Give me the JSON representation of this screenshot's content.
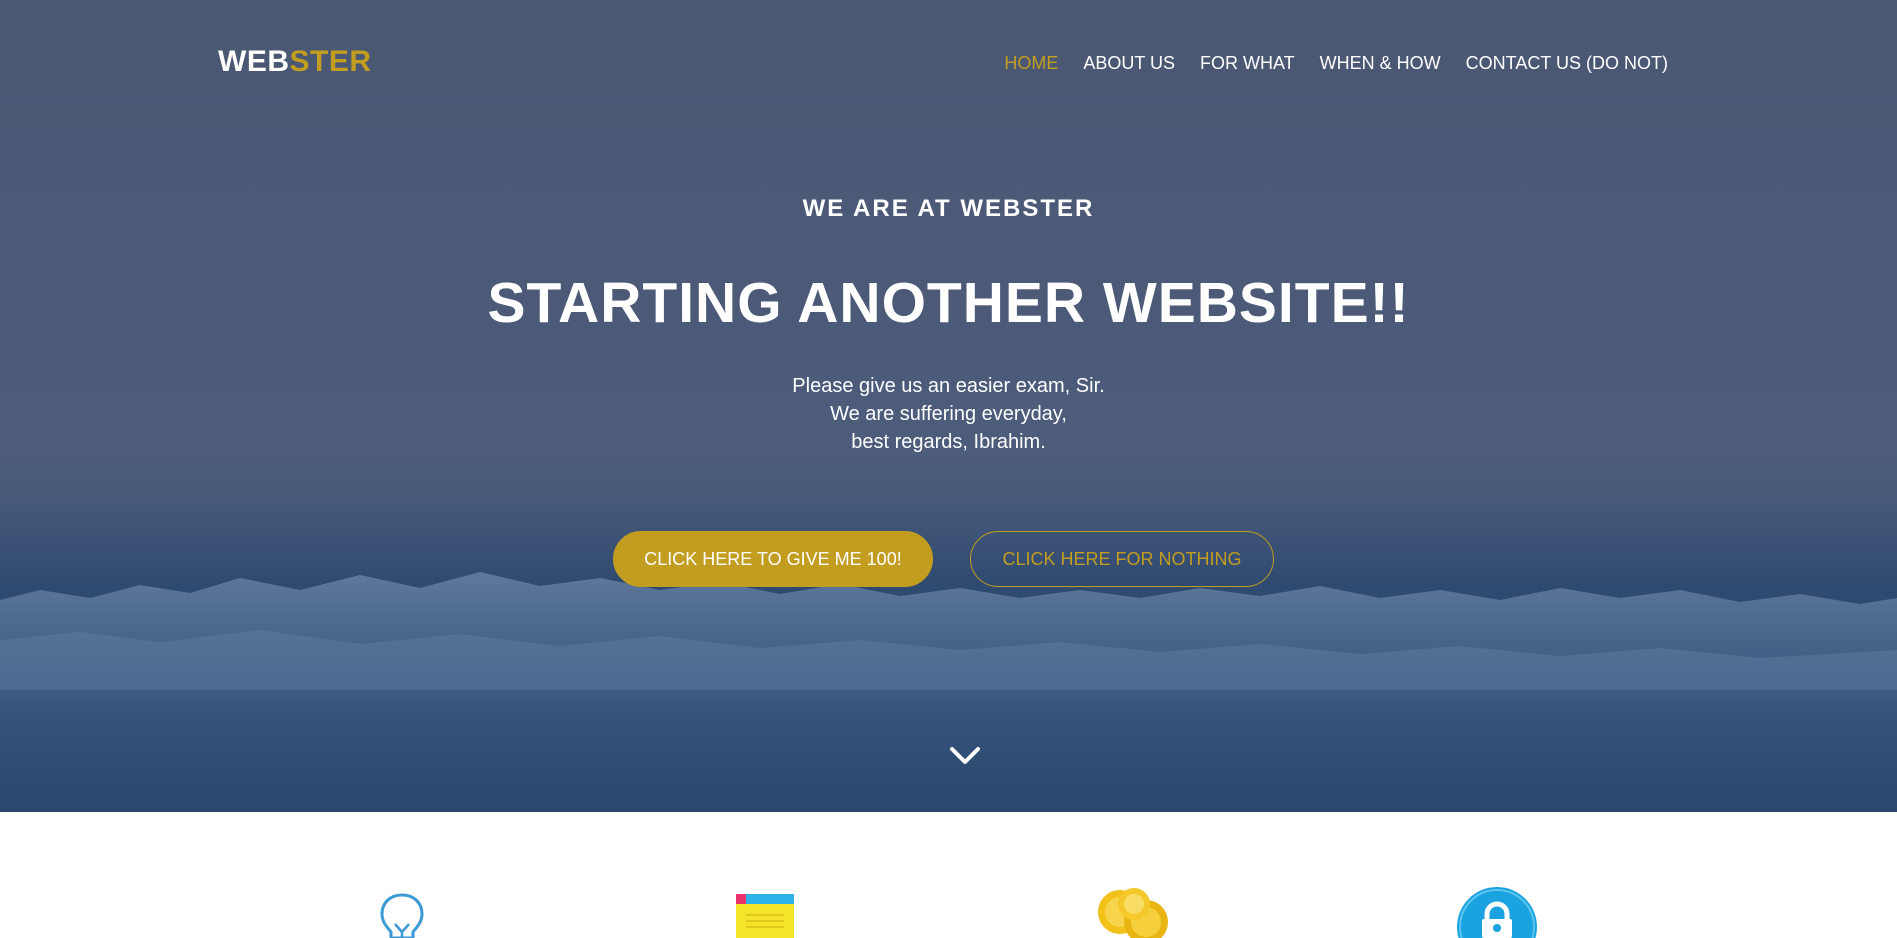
{
  "logo": {
    "part1": "WEB",
    "part2": "STER"
  },
  "nav": {
    "items": [
      {
        "label": "HOME",
        "active": true
      },
      {
        "label": "ABOUT US",
        "active": false
      },
      {
        "label": "FOR WHAT",
        "active": false
      },
      {
        "label": "WHEN & HOW",
        "active": false
      },
      {
        "label": "CONTACT US (DO NOT)",
        "active": false
      }
    ]
  },
  "hero": {
    "eyebrow": "WE ARE AT WEBSTER",
    "headline": "STARTING ANOTHER WEBSITE!!",
    "lines": [
      "Please give us an easier exam, Sir.",
      "We are suffering everyday,",
      "best regards, Ibrahim."
    ],
    "primary_button": "CLICK HERE TO GIVE ME 100!",
    "secondary_button": "CLICK HERE FOR NOTHING",
    "scroll_icon": "chevron-down-icon"
  },
  "features": {
    "icons": [
      "lightbulb-icon",
      "notebook-icon",
      "coins-icon",
      "lock-icon"
    ]
  },
  "colors": {
    "accent": "#c29d20",
    "hero_overlay": "#4b5873",
    "text_light": "#ffffff",
    "lock_blue": "#1aa3e0",
    "bulb_blue": "#3b9ad6",
    "notebook_yellow": "#f5e52a",
    "coin_gold": "#f2c21a"
  }
}
